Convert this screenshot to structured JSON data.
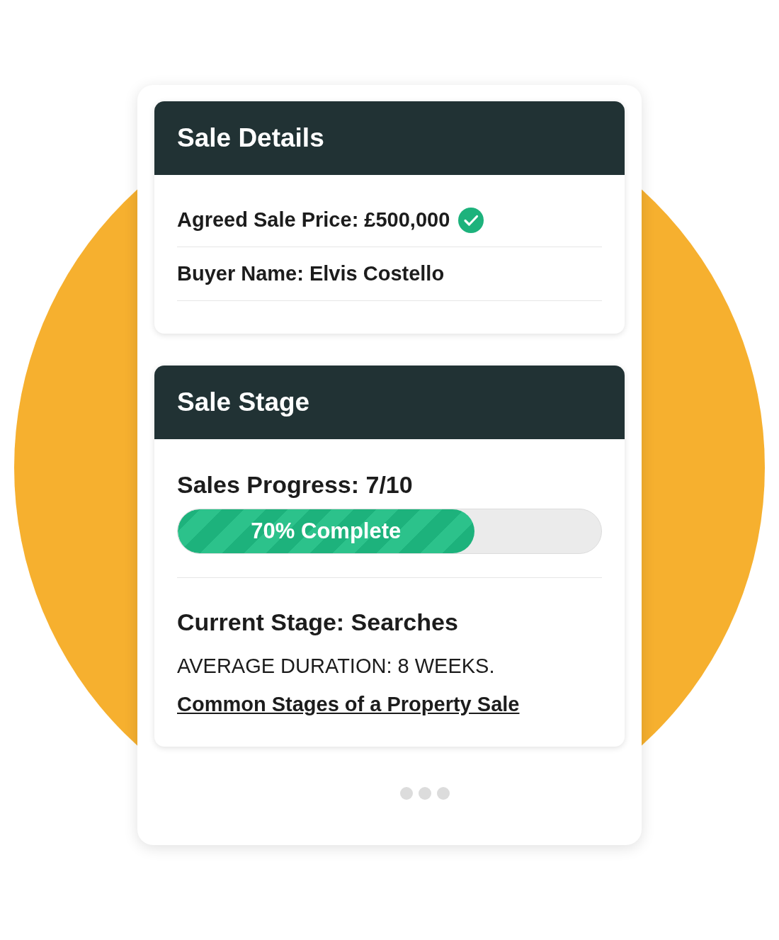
{
  "sale_details": {
    "title": "Sale Details",
    "rows": [
      {
        "label": "Agreed Sale Price: £500,000",
        "verified": true
      },
      {
        "label": "Buyer Name: Elvis Costello",
        "verified": false
      }
    ]
  },
  "sale_stage": {
    "title": "Sale Stage",
    "progress_label": "Sales Progress: 7/10",
    "progress": {
      "level": 0.7,
      "label": "70% Complete"
    },
    "current_stage": "Current Stage: Searches",
    "duration": "AVERAGE DURATION: 8 WEEKS.",
    "link": "Common Stages of a Property Sale"
  }
}
